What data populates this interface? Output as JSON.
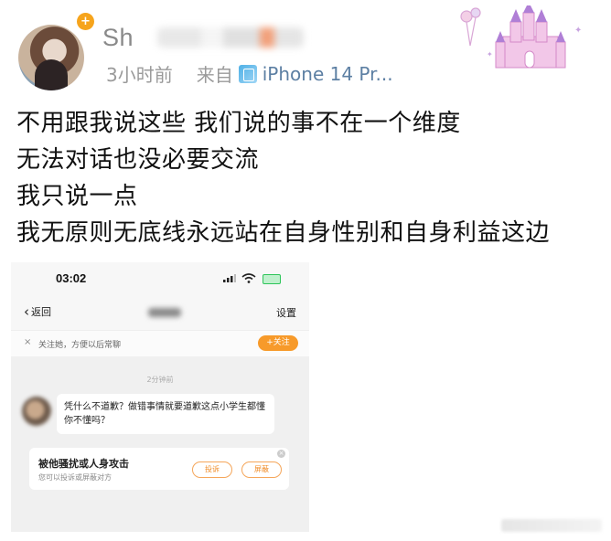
{
  "post": {
    "user": {
      "name_prefix": "Sh",
      "time": "3小时前",
      "from_label": "来自",
      "device": "iPhone 14 Pr..."
    },
    "lines": [
      "不用跟我说这些 我们说的事不在一个维度",
      "无法对话也没必要交流",
      "我只说一点",
      "我无原则无底线永远站在自身性别和自身利益这边"
    ]
  },
  "embedded_screenshot": {
    "status_time": "03:02",
    "nav": {
      "back_label": "返回",
      "settings_label": "设置"
    },
    "follow_bar": {
      "close_glyph": "×",
      "tip": "关注她，方便以后常聊",
      "follow_label": "+关注"
    },
    "timestamp": "2分钟前",
    "message": "凭什么不道歉？做错事情就要道歉这点小学生都懂你不懂吗？",
    "warning": {
      "title": "被他骚扰或人身攻击",
      "subtitle": "您可以投诉或屏蔽对方",
      "report_label": "投诉",
      "block_label": "屏蔽",
      "close_glyph": "×"
    }
  },
  "colors": {
    "accent_orange": "#f79a2a",
    "meta_gray": "#9a9a9a",
    "device_blue": "#5c7fa3"
  }
}
